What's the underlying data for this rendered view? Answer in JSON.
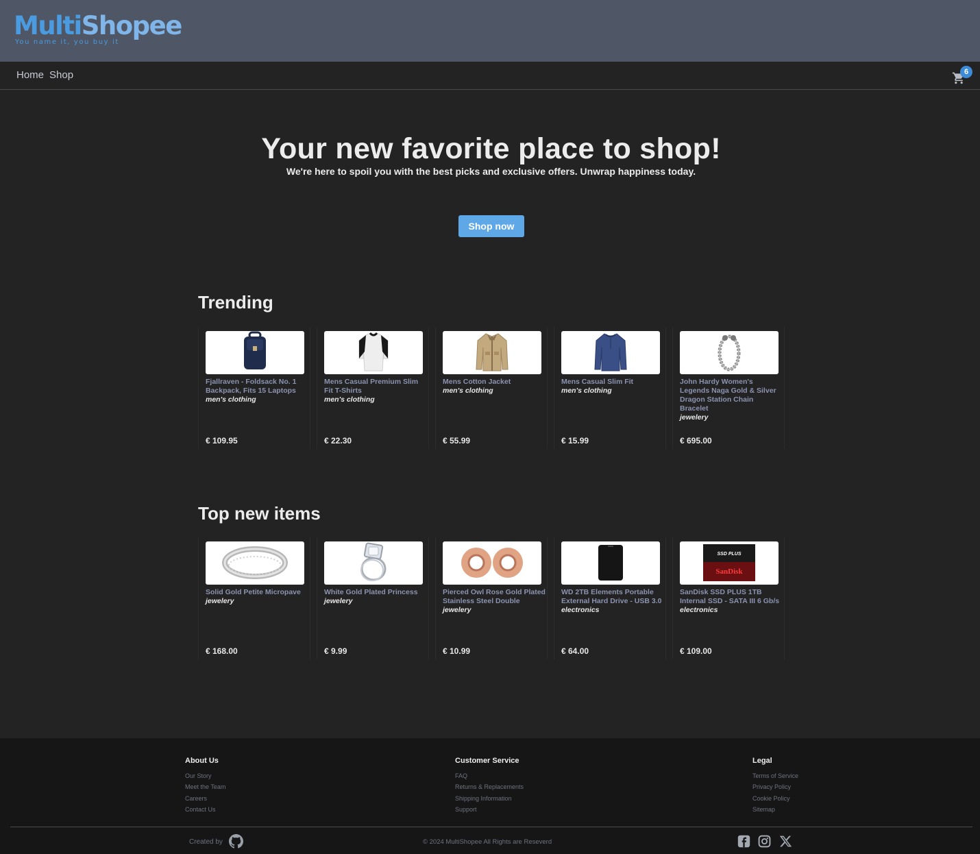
{
  "brand": {
    "name_part1": "Multi",
    "name_part2": "Shopee",
    "tagline": "You name it, you buy it"
  },
  "nav": {
    "home": "Home",
    "shop": "Shop",
    "cart_count": "6"
  },
  "hero": {
    "title": "Your new favorite place to shop!",
    "subtitle": "We're here to spoil you with the best picks and exclusive offers. Unwrap happiness today.",
    "button": "Shop now"
  },
  "trending": {
    "title": "Trending",
    "items": [
      {
        "title": "Fjallraven - Foldsack No. 1 Backpack, Fits 15 Laptops",
        "category": "men's clothing",
        "price": "€ 109.95",
        "icon": "backpack-image"
      },
      {
        "title": "Mens Casual Premium Slim Fit T-Shirts",
        "category": "men's clothing",
        "price": "€ 22.30",
        "icon": "tshirt-image"
      },
      {
        "title": "Mens Cotton Jacket",
        "category": "men's clothing",
        "price": "€ 55.99",
        "icon": "jacket-image"
      },
      {
        "title": "Mens Casual Slim Fit",
        "category": "men's clothing",
        "price": "€ 15.99",
        "icon": "longsleeve-image"
      },
      {
        "title": "John Hardy Women's Legends Naga Gold & Silver Dragon Station Chain Bracelet",
        "category": "jewelery",
        "price": "€ 695.00",
        "icon": "bracelet-image"
      }
    ]
  },
  "new_items": {
    "title": "Top new items",
    "items": [
      {
        "title": "Solid Gold Petite Micropave",
        "category": "jewelery",
        "price": "€ 168.00",
        "icon": "ring-image"
      },
      {
        "title": "White Gold Plated Princess",
        "category": "jewelery",
        "price": "€ 9.99",
        "icon": "engagement-ring-image"
      },
      {
        "title": "Pierced Owl Rose Gold Plated Stainless Steel Double",
        "category": "jewelery",
        "price": "€ 10.99",
        "icon": "ear-plugs-image"
      },
      {
        "title": "WD 2TB Elements Portable External Hard Drive - USB 3.0",
        "category": "electronics",
        "price": "€ 64.00",
        "icon": "hard-drive-image"
      },
      {
        "title": "SanDisk SSD PLUS 1TB Internal SSD - SATA III 6 Gb/s",
        "category": "electronics",
        "price": "€ 109.00",
        "icon": "ssd-image"
      }
    ]
  },
  "footer": {
    "about": {
      "title": "About Us",
      "links": [
        "Our Story",
        "Meet the Team",
        "Careers",
        "Contact Us"
      ]
    },
    "service": {
      "title": "Customer Service",
      "links": [
        "FAQ",
        "Returns & Replacements",
        "Shipping Information",
        "Support"
      ]
    },
    "legal": {
      "title": "Legal",
      "links": [
        "Terms of Service",
        "Privacy Policy",
        "Cookie Policy",
        "Sitemap"
      ]
    },
    "created_by": "Created by",
    "copyright": "© 2024 MultiShopee All Rights are Reseverd"
  },
  "ssd_label": {
    "line1": "SSD PLUS",
    "brand": "SanDisk"
  },
  "colors": {
    "accent": "#5ea8e8",
    "header_bg": "#4f5665",
    "page_bg": "#232323",
    "footer_bg": "#161616"
  }
}
